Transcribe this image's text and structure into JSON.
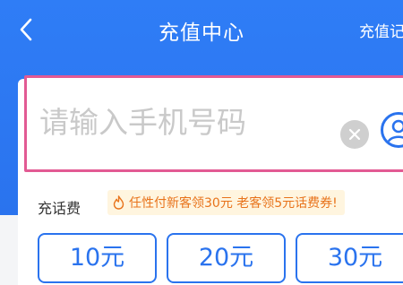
{
  "header": {
    "title": "充值中心",
    "right_link": "充值记录"
  },
  "phone": {
    "placeholder": "请输入手机号码",
    "value": ""
  },
  "recharge": {
    "section_label": "充话费",
    "promo_text": "任性付新客领30元 老客领5元话费券!",
    "amounts": [
      "10元",
      "20元",
      "30元"
    ]
  },
  "colors": {
    "brand_blue": "#2a73ee",
    "promo_orange": "#e8731b",
    "promo_bg": "#fff5df",
    "focus_border": "#e25a93"
  }
}
